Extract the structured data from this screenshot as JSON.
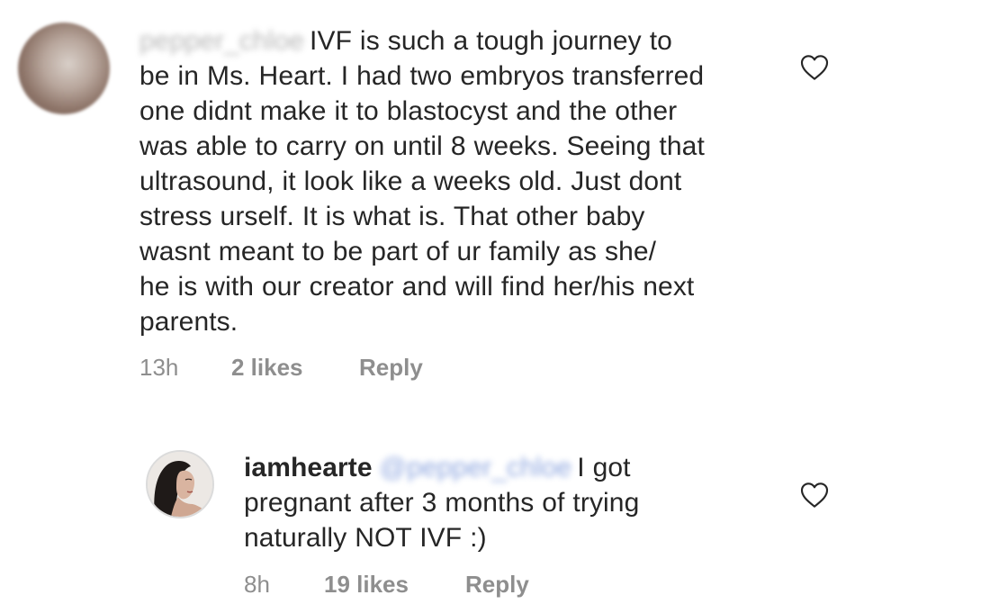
{
  "comments": [
    {
      "username_blurred": "pepper_chloe",
      "lines": [
        "IVF is such a tough journey to",
        "be in Ms. Heart. I had two embryos transferred",
        "one didnt make it to blastocyst and the other",
        "was able to carry on until 8 weeks. Seeing that",
        "ultrasound, it look like a weeks old. Just dont",
        "stress urself. It is what is. That other baby",
        "wasnt meant to be part of ur family as she/",
        "he is with our creator and will find her/his next",
        "parents."
      ],
      "time": "13h",
      "likes": "2 likes",
      "reply_label": "Reply"
    },
    {
      "username": "iamhearte",
      "mention_blurred": "@pepper_chloe",
      "lines": [
        "I got",
        "pregnant after 3 months of trying",
        "naturally NOT IVF :)"
      ],
      "time": "8h",
      "likes": "19 likes",
      "reply_label": "Reply"
    }
  ],
  "icons": {
    "like": "heart-outline-icon"
  }
}
